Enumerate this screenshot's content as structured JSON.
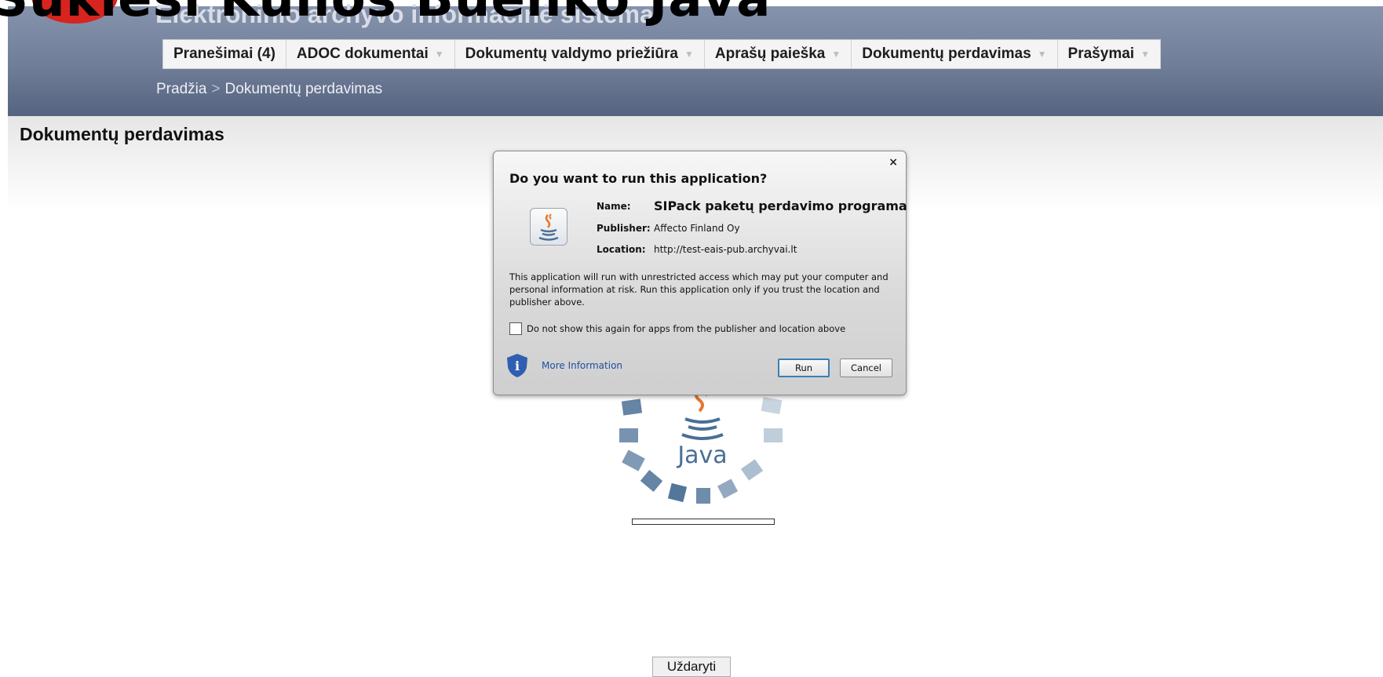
{
  "overlay_caption": "Sukiesi Kulios Buenko Java",
  "app": {
    "title": "Elektroninio archyvo informacinė sistema"
  },
  "menu": [
    {
      "label": "Pranešimai (4)",
      "has_dropdown": false
    },
    {
      "label": "ADOC dokumentai",
      "has_dropdown": true
    },
    {
      "label": "Dokumentų valdymo priežiūra",
      "has_dropdown": true
    },
    {
      "label": "Aprašų paieška",
      "has_dropdown": true
    },
    {
      "label": "Dokumentų perdavimas",
      "has_dropdown": true
    },
    {
      "label": "Prašymai",
      "has_dropdown": true
    }
  ],
  "breadcrumb": {
    "home": "Pradžia",
    "separator": ">",
    "current": "Dokumentų perdavimas"
  },
  "page": {
    "title": "Dokumentų perdavimas",
    "close_button": "Uždaryti"
  },
  "java_splash": {
    "label": "Java",
    "progress": 0.0
  },
  "dialog": {
    "heading": "Do you want to run this application?",
    "close_glyph": "×",
    "name_label": "Name:",
    "name_value": "SIPack paketų perdavimo programa",
    "publisher_label": "Publisher:",
    "publisher_value": "Affecto Finland Oy",
    "location_label": "Location:",
    "location_value": "http://test-eais-pub.archyvai.lt",
    "warning": "This application will run with unrestricted access which may put your computer and personal information at risk. Run this application only if you trust the location and publisher above.",
    "checkbox_label": "Do not show this again for apps from the publisher and location above",
    "checkbox_checked": false,
    "more_info": "More Information",
    "run_button": "Run",
    "cancel_button": "Cancel"
  },
  "colors": {
    "header_top": "#8593ad",
    "header_bottom": "#566380",
    "java_blue": "#4a6f96",
    "java_orange": "#e8762b",
    "logo_red": "#d7241f"
  },
  "icons": [
    "java-cup-icon",
    "info-shield-icon",
    "close-icon",
    "chevron-down-icon"
  ]
}
